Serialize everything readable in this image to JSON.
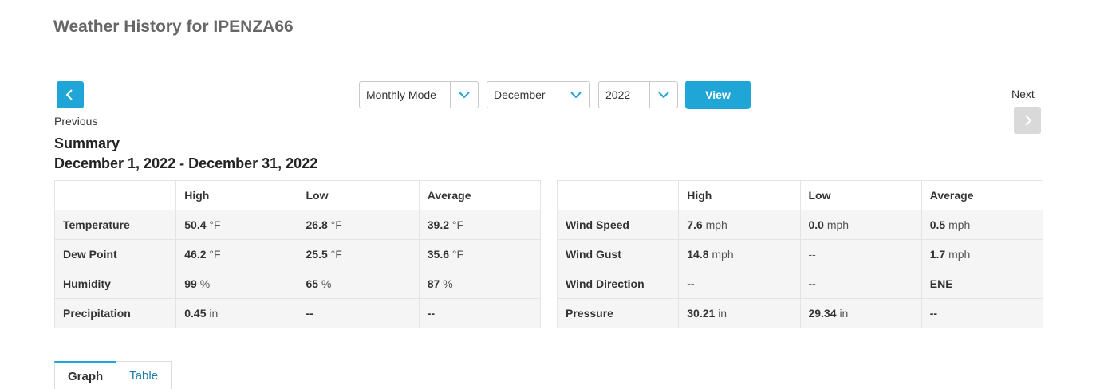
{
  "page": {
    "title": "Weather History for IPENZA66"
  },
  "nav": {
    "previous_label": "Previous",
    "next_label": "Next"
  },
  "controls": {
    "mode_value": "Monthly Mode",
    "month_value": "December",
    "year_value": "2022",
    "view_label": "View"
  },
  "summary": {
    "heading": "Summary",
    "date_range": "December 1, 2022 - December 31, 2022",
    "left_table": {
      "headers": [
        "",
        "High",
        "Low",
        "Average"
      ],
      "rows": [
        {
          "label": "Temperature",
          "high": {
            "num": "50.4",
            "unit": "°F"
          },
          "low": {
            "num": "26.8",
            "unit": "°F"
          },
          "avg": {
            "num": "39.2",
            "unit": "°F"
          }
        },
        {
          "label": "Dew Point",
          "high": {
            "num": "46.2",
            "unit": "°F"
          },
          "low": {
            "num": "25.5",
            "unit": "°F"
          },
          "avg": {
            "num": "35.6",
            "unit": "°F"
          }
        },
        {
          "label": "Humidity",
          "high": {
            "num": "99",
            "unit": "%"
          },
          "low": {
            "num": "65",
            "unit": "%"
          },
          "avg": {
            "num": "87",
            "unit": "%"
          }
        },
        {
          "label": "Precipitation",
          "high": {
            "num": "0.45",
            "unit": "in"
          },
          "low": {
            "num": "--",
            "unit": ""
          },
          "avg": {
            "num": "--",
            "unit": ""
          }
        }
      ]
    },
    "right_table": {
      "headers": [
        "",
        "High",
        "Low",
        "Average"
      ],
      "rows": [
        {
          "label": "Wind Speed",
          "high": {
            "num": "7.6",
            "unit": "mph"
          },
          "low": {
            "num": "0.0",
            "unit": "mph"
          },
          "avg": {
            "num": "0.5",
            "unit": "mph"
          }
        },
        {
          "label": "Wind Gust",
          "high": {
            "num": "14.8",
            "unit": "mph"
          },
          "low": {
            "num": "",
            "unit": "--"
          },
          "avg": {
            "num": "1.7",
            "unit": "mph"
          }
        },
        {
          "label": "Wind Direction",
          "high": {
            "num": "--",
            "unit": ""
          },
          "low": {
            "num": "--",
            "unit": ""
          },
          "avg": {
            "num": "ENE",
            "unit": ""
          }
        },
        {
          "label": "Pressure",
          "high": {
            "num": "30.21",
            "unit": "in"
          },
          "low": {
            "num": "29.34",
            "unit": "in"
          },
          "avg": {
            "num": "--",
            "unit": ""
          }
        }
      ]
    }
  },
  "tabs": [
    {
      "label": "Graph",
      "active": true
    },
    {
      "label": "Table",
      "active": false
    }
  ],
  "colors": {
    "accent": "#1fa6d6",
    "disabled": "#d9d9d9",
    "row_bg": "#f5f5f5",
    "title_gray": "#666666"
  },
  "icons": {
    "previous": "chevron-left-icon",
    "next": "chevron-right-icon",
    "dropdown": "chevron-down-icon"
  }
}
